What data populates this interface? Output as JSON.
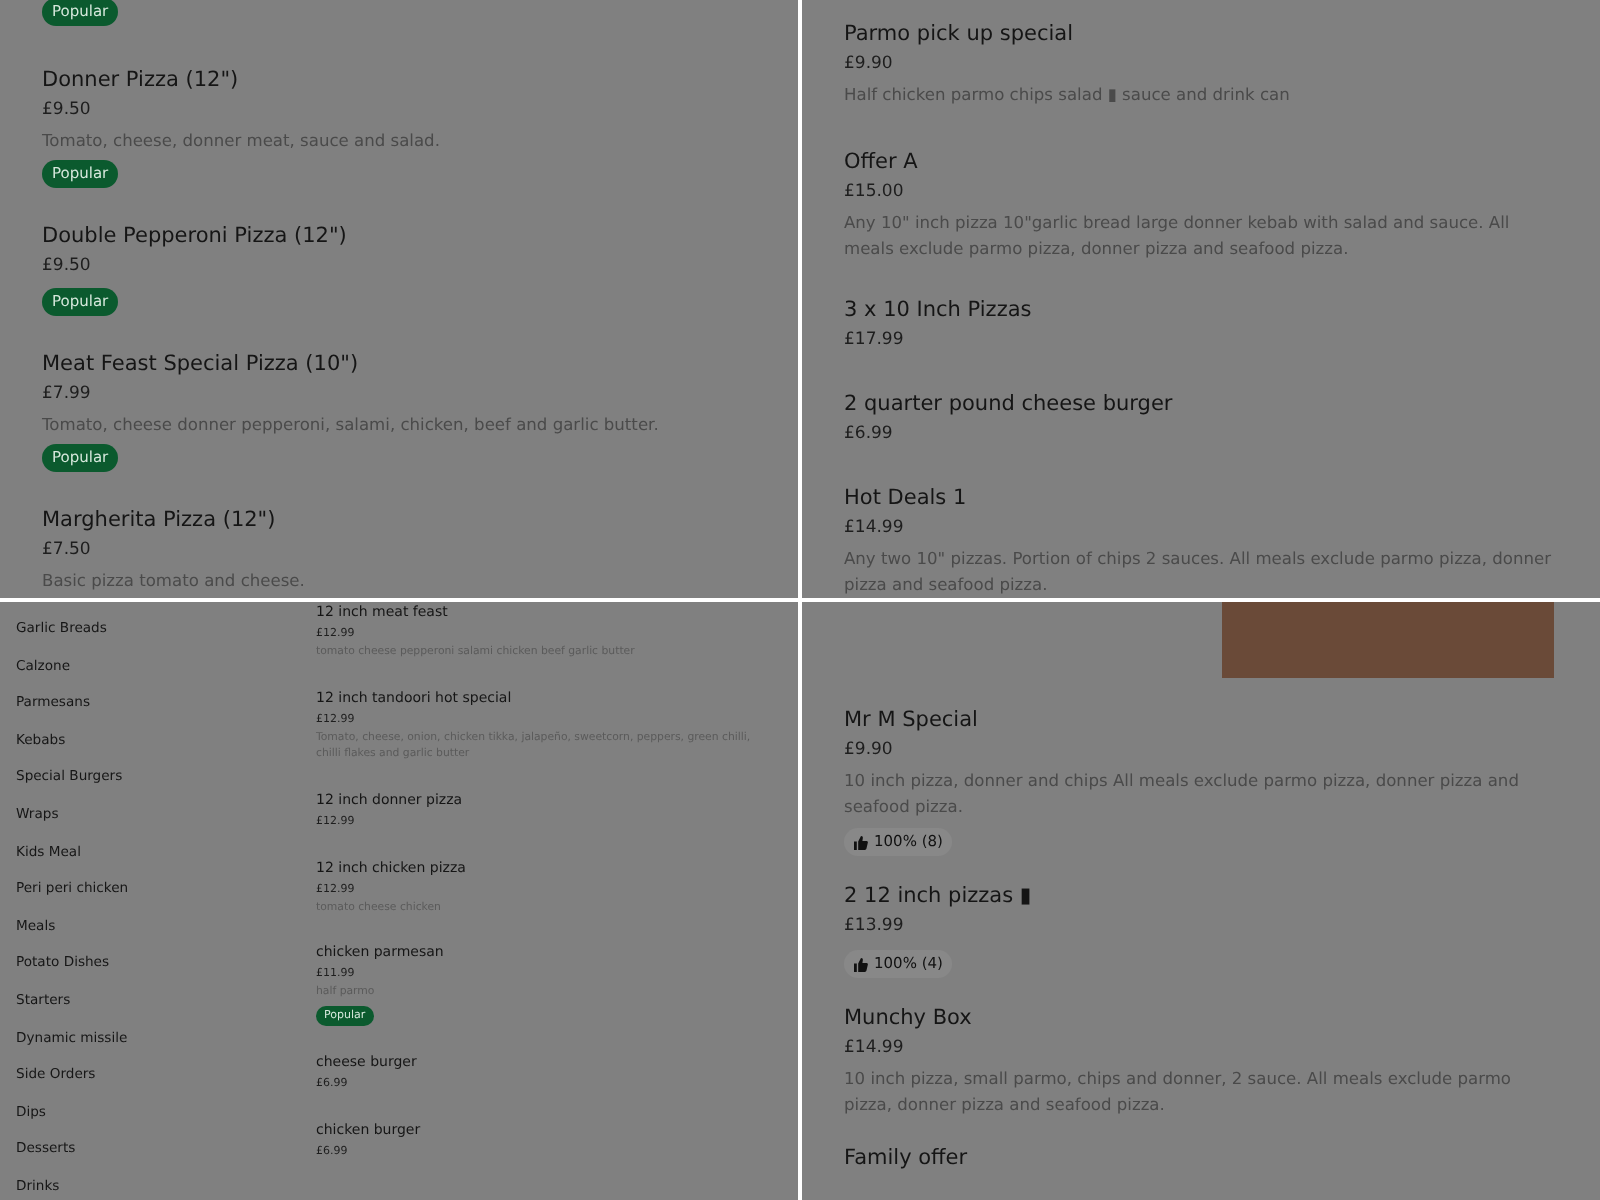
{
  "panels": [
    {
      "kind": "menu",
      "items": [
        {
          "badge": "Popular"
        },
        {
          "name": "Donner Pizza (12\")",
          "price": "£9.50",
          "description": "Tomato, cheese, donner meat, sauce and salad.",
          "badge": "Popular"
        },
        {
          "name": "Double Pepperoni Pizza (12\")",
          "price": "£9.50",
          "badge": "Popular"
        },
        {
          "name": "Meat Feast Special Pizza (10\")",
          "price": "£7.99",
          "description": "Tomato, cheese donner pepperoni, salami, chicken, beef and garlic butter.",
          "badge": "Popular"
        },
        {
          "name": "Margherita Pizza (12\")",
          "price": "£7.50",
          "description": "Basic pizza tomato and cheese."
        }
      ]
    },
    {
      "kind": "menu",
      "items": [
        {
          "name": "Parmo pick up special",
          "price": "£9.90",
          "description": "Half chicken parmo chips salad ▮ sauce and drink can"
        },
        {
          "name": "Offer A",
          "price": "£15.00",
          "description": "Any 10\" inch pizza 10\"garlic bread large donner kebab with salad and sauce. All meals exclude parmo pizza, donner pizza and seafood pizza."
        },
        {
          "name": "3 x 10 Inch Pizzas",
          "price": "£17.99"
        },
        {
          "name": "2 quarter pound cheese burger",
          "price": "£6.99"
        },
        {
          "name": "Hot Deals 1",
          "price": "£14.99",
          "description": "Any two 10\" pizzas. Portion of chips 2 sauces. All meals exclude parmo pizza, donner pizza and seafood pizza."
        }
      ]
    },
    {
      "kind": "sidebar",
      "categories": [
        "Garlic Breads",
        "Calzone",
        "Parmesans",
        "Kebabs",
        "Special Burgers",
        "Wraps",
        "Kids Meal",
        "Peri peri chicken",
        "Meals",
        "Potato Dishes",
        "Starters",
        "Dynamic missile",
        "Side Orders",
        "Dips",
        "Desserts",
        "Drinks"
      ],
      "items": [
        {
          "name": "12 inch meat feast",
          "price": "£12.99",
          "description": "tomato cheese pepperoni salami chicken beef garlic butter"
        },
        {
          "name": "12 inch tandoori hot special",
          "price": "£12.99",
          "description": "Tomato, cheese, onion, chicken tikka, jalapeño, sweetcorn, peppers, green chilli, chilli flakes and garlic butter"
        },
        {
          "name": "12 inch donner pizza",
          "price": "£12.99"
        },
        {
          "name": "12 inch chicken pizza",
          "price": "£12.99",
          "description": "tomato cheese chicken"
        },
        {
          "name": "chicken parmesan",
          "price": "£11.99",
          "description": "half parmo",
          "badge": "Popular"
        },
        {
          "name": "cheese burger",
          "price": "£6.99"
        },
        {
          "name": "chicken burger",
          "price": "£6.99"
        }
      ]
    },
    {
      "kind": "photo",
      "items": [
        {
          "name": "Mr M Special",
          "price": "£9.90",
          "description": "10 inch pizza, donner and chips All meals exclude parmo pizza, donner pizza and seafood pizza.",
          "rating": "100% (8)"
        },
        {
          "name": "2 12 inch pizzas ▮",
          "price": "£13.99",
          "rating": "100% (4)"
        },
        {
          "name": "Munchy Box",
          "price": "£14.99",
          "description": "10 inch pizza, small parmo, chips and donner, 2 sauce. All meals exclude parmo pizza, donner pizza and seafood pizza."
        },
        {
          "name": "Family offer"
        }
      ]
    }
  ]
}
